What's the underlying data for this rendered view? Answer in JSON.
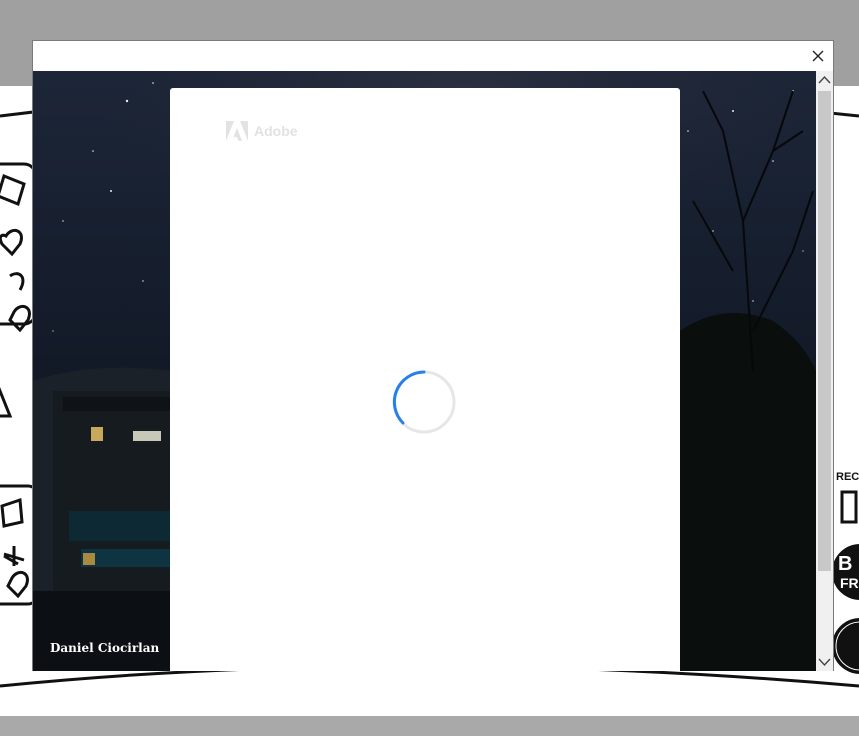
{
  "modal": {
    "close_label": "Close",
    "photo_credit": "Daniel Ciocirlan"
  },
  "card": {
    "logo_text": "Adobe",
    "loading": true
  },
  "colors": {
    "spinner": "#2680eb",
    "sky_top": "#1a2232",
    "sky_bottom": "#050a12"
  },
  "icons": [
    "close-icon",
    "adobe-logo-icon",
    "loading-spinner-icon",
    "chevron-up-icon",
    "chevron-down-icon"
  ]
}
